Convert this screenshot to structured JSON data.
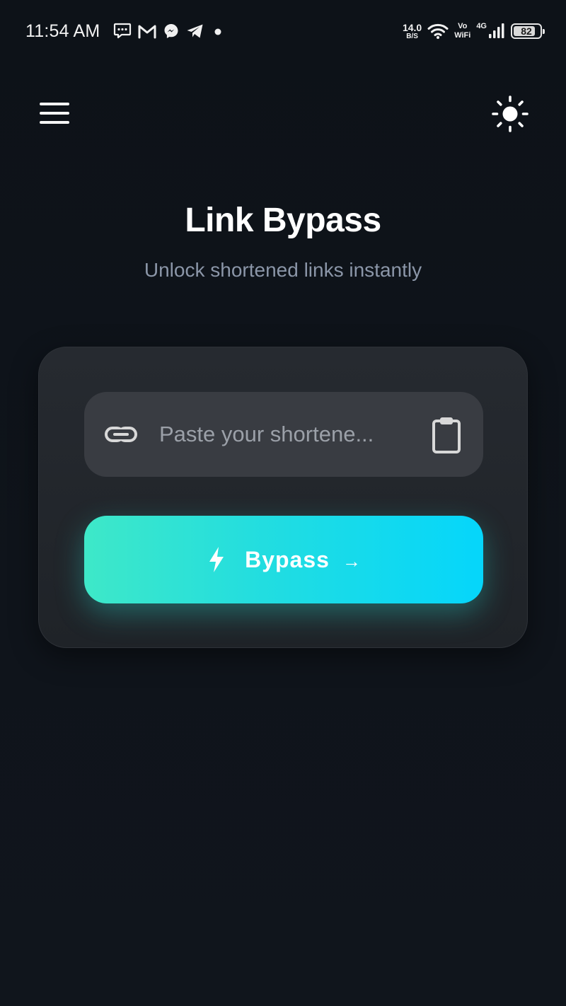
{
  "status_bar": {
    "time": "11:54 AM",
    "notification_icons": [
      "chat-icon",
      "gmail-icon",
      "messenger-icon",
      "telegram-icon",
      "dot-icon"
    ],
    "net_speed_value": "14.0",
    "net_speed_unit": "B/S",
    "vowifi_top": "Vo",
    "vowifi_bottom": "WiFi",
    "network_type": "4G",
    "battery_level": "82"
  },
  "app_bar": {
    "menu_icon": "menu-icon",
    "theme_icon": "sun-icon"
  },
  "header": {
    "title": "Link Bypass",
    "subtitle": "Unlock shortened links instantly"
  },
  "form": {
    "url_placeholder": "Paste your shortene...",
    "url_value": "",
    "bypass_label": "Bypass",
    "bypass_arrow": "→"
  },
  "colors": {
    "background": "#0f141b",
    "card": "#24282d",
    "field": "#393c42",
    "accent_start": "#3ee8c8",
    "accent_end": "#05d6fb",
    "subtitle": "#8b96a8"
  }
}
